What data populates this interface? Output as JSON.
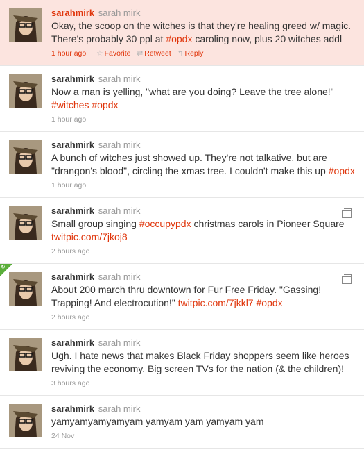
{
  "colors": {
    "accent": "#e0350b",
    "highlight_bg": "#fce4df",
    "muted": "#999999"
  },
  "actions": {
    "favorite": "Favorite",
    "retweet": "Retweet",
    "reply": "Reply"
  },
  "tweets": [
    {
      "screen_name": "sarahmirk",
      "full_name": "sarah mirk",
      "parts": [
        "Okay, the scoop on the witches is that they're healing greed w/ magic. There's probably 30 ppl at ",
        "#opdx",
        " caroling now, plus 20 witches addl"
      ],
      "time": "1 hour ago",
      "highlight": true
    },
    {
      "screen_name": "sarahmirk",
      "full_name": "sarah mirk",
      "parts": [
        "Now a man is yelling, \"what are you doing? Leave the tree alone!\" ",
        "#witches",
        " ",
        "#opdx"
      ],
      "time": "1 hour ago"
    },
    {
      "screen_name": "sarahmirk",
      "full_name": "sarah mirk",
      "parts": [
        "A bunch of witches just showed up. They're not talkative, but are \"drangon's blood\", circling the xmas tree. I couldn't make this up ",
        "#opdx"
      ],
      "time": "1 hour ago"
    },
    {
      "screen_name": "sarahmirk",
      "full_name": "sarah mirk",
      "parts": [
        "Small group singing ",
        "#occupypdx",
        " christmas carols in Pioneer Square ",
        "twitpic.com/7jkoj8"
      ],
      "time": "2 hours ago",
      "media": true
    },
    {
      "screen_name": "sarahmirk",
      "full_name": "sarah mirk",
      "parts": [
        "About 200 march thru downtown for Fur Free Friday. \"Gassing! Trapping! And electrocution!\" ",
        "twitpic.com/7jkkl7",
        " ",
        "#opdx"
      ],
      "time": "2 hours ago",
      "media": true,
      "retweeted": true
    },
    {
      "screen_name": "sarahmirk",
      "full_name": "sarah mirk",
      "parts": [
        "Ugh. I hate news that makes Black Friday shoppers seem like heroes reviving the economy. Big screen TVs for the nation (& the children)!"
      ],
      "time": "3 hours ago"
    },
    {
      "screen_name": "sarahmirk",
      "full_name": "sarah mirk",
      "parts": [
        "yamyamyamyamyam yamyam yam yamyam yam"
      ],
      "time": "24 Nov"
    }
  ]
}
